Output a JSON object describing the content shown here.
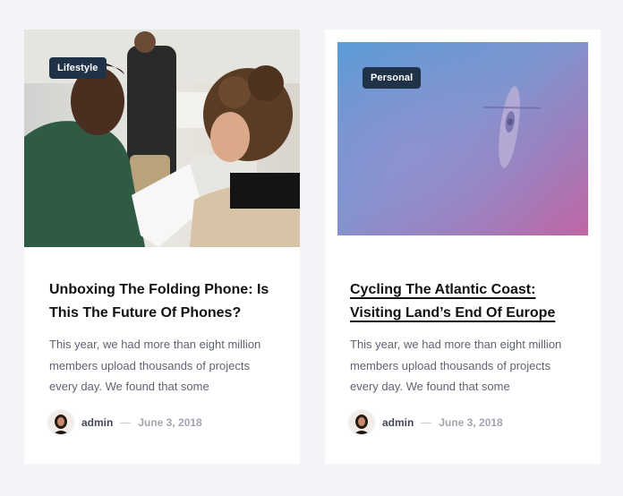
{
  "posts": [
    {
      "category": "Lifestyle",
      "title": "Unboxing The Folding Phone: Is This The Future Of Phones?",
      "excerpt": "This year, we had more than eight million members upload thousands of projects every day. We found that some",
      "author": "admin",
      "date": "June 3, 2018",
      "image": "photo-people-discussing-icon"
    },
    {
      "category": "Personal",
      "title": "Cycling The Atlantic Coast: Visiting Land’s End Of Europe",
      "excerpt": "This year, we had more than eight million members upload thousands of projects every day. We found that some",
      "author": "admin",
      "date": "June 3, 2018",
      "image": "photo-kayak-aerial-icon"
    }
  ],
  "colors": {
    "badge_bg": "#1f3247",
    "page_bg": "#f3f3f8",
    "card_bg": "#ffffff",
    "title": "#111111",
    "excerpt": "#5f6470",
    "meta": "#9aa0aa"
  }
}
